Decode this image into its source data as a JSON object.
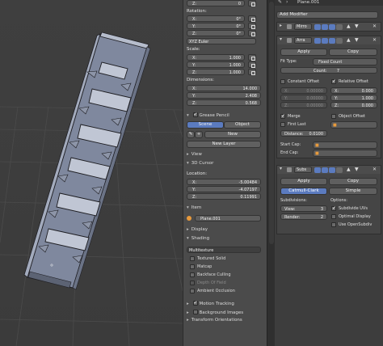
{
  "header": {
    "object_name": "Plane.001"
  },
  "npanel": {
    "top_z": {
      "axis": "Z:",
      "value": "0"
    },
    "rotation": {
      "label": "Rotation:",
      "fields": [
        {
          "axis": "X:",
          "value": "0°"
        },
        {
          "axis": "Y:",
          "value": "0°"
        },
        {
          "axis": "Z:",
          "value": "0°"
        }
      ],
      "mode": "XYZ Euler"
    },
    "scale": {
      "label": "Scale:",
      "fields": [
        {
          "axis": "X:",
          "value": "1.000"
        },
        {
          "axis": "Y:",
          "value": "1.000"
        },
        {
          "axis": "Z:",
          "value": "1.000"
        }
      ]
    },
    "dimensions": {
      "label": "Dimensions:",
      "fields": [
        {
          "axis": "X:",
          "value": "14.000"
        },
        {
          "axis": "Y:",
          "value": "2.408"
        },
        {
          "axis": "Z:",
          "value": "0.568"
        }
      ]
    },
    "grease_pencil": {
      "label": "Grease Pencil",
      "tab_scene": "Scene",
      "tab_object": "Object",
      "new_label": "New",
      "new_layer_label": "New Layer"
    },
    "view_label": "View",
    "cursor": {
      "label": "3D Cursor",
      "location_label": "Location:",
      "fields": [
        {
          "axis": "X:",
          "value": "-5.00484"
        },
        {
          "axis": "Y:",
          "value": "-4.07197"
        },
        {
          "axis": "Z:",
          "value": "0.11991"
        }
      ]
    },
    "item": {
      "label": "Item",
      "name": "Plane.001"
    },
    "display_label": "Display",
    "shading": {
      "label": "Shading",
      "mode": "Multitexture",
      "options": [
        {
          "label": "Textured Solid",
          "checked": false,
          "dim": false
        },
        {
          "label": "Matcap",
          "checked": false,
          "dim": false
        },
        {
          "label": "Backface Culling",
          "checked": false,
          "dim": false
        },
        {
          "label": "Depth Of Field",
          "checked": false,
          "dim": true
        },
        {
          "label": "Ambient Occlusion",
          "checked": false,
          "dim": false
        }
      ]
    },
    "motion_tracking": {
      "label": "Motion Tracking",
      "checked": true
    },
    "background_images": {
      "label": "Background Images",
      "checked": false
    },
    "transform_orientations": "Transform Orientations"
  },
  "modifiers": {
    "add_label": "Add Modifier",
    "mirror": {
      "name": "Mirro"
    },
    "array": {
      "name": "Arra",
      "apply": "Apply",
      "copy": "Copy",
      "fit_type_label": "Fit Type:",
      "fit_type_value": "Fixed Count",
      "count_label": "Count:",
      "count_value": "7",
      "constant_offset": "Constant Offset",
      "relative_offset": "Relative Offset",
      "constant_fields": [
        {
          "axis": "X:",
          "value": "0.00000"
        },
        {
          "axis": "Y:",
          "value": "0.00000"
        },
        {
          "axis": "Z:",
          "value": "0.00000"
        }
      ],
      "relative_fields": [
        {
          "axis": "X:",
          "value": "0.000"
        },
        {
          "axis": "Y:",
          "value": "1.000"
        },
        {
          "axis": "Z:",
          "value": "0.000"
        }
      ],
      "merge": "Merge",
      "first_last": "First Last",
      "distance_label": "Distance:",
      "distance_value": "0.0100",
      "object_offset": "Object Offset",
      "start_cap": "Start Cap:",
      "end_cap": "End Cap:"
    },
    "subsurf": {
      "name": "Subs",
      "apply": "Apply",
      "copy": "Copy",
      "tab_cc": "Catmull-Clark",
      "tab_simple": "Simple",
      "subdivisions": "Subdivisions:",
      "options": "Options:",
      "view_label": "View:",
      "view_value": "3",
      "render_label": "Render:",
      "render_value": "2",
      "subdivide_uvs": "Subdivide UVs",
      "optimal_display": "Optimal Display",
      "use_opensubdiv": "Use OpenSubdiv"
    }
  },
  "colors": {
    "accent": "#5b7bbf",
    "grid": "#4a4a4a",
    "mesh": "#9aa3b8",
    "mesh_edge": "#1e1e22",
    "viewport_bg": "#3d3d3d"
  }
}
